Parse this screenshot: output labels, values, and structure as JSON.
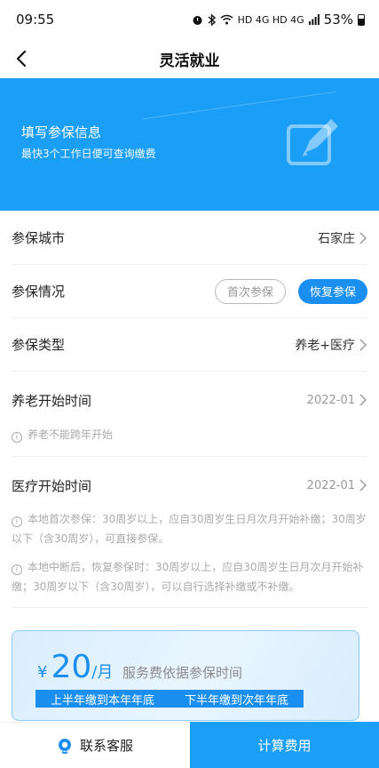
{
  "status_bar": {
    "time": "09:55",
    "network": "HD 4G HD 4G",
    "battery": "53%"
  },
  "nav": {
    "title": "灵活就业"
  },
  "banner": {
    "title": "填写参保信息",
    "subtitle": "最快3个工作日便可查询缴费"
  },
  "form": {
    "city": {
      "label": "参保城市",
      "value": "石家庄"
    },
    "status": {
      "label": "参保情况",
      "option_first": "首次参保",
      "option_resume": "恢复参保"
    },
    "type": {
      "label": "参保类型",
      "value": "养老+医疗"
    },
    "pension_start": {
      "label": "养老开始时间",
      "value": "2022-01",
      "note": "养老不能跨年开始"
    },
    "medical_start": {
      "label": "医疗开始时间",
      "value": "2022-01",
      "note1": "本地首次参保：30周岁以上，应自30周岁生日月次月开始补缴；30周岁以下（含30周岁），可直接参保。",
      "note2": "本地中断后，恢复参保时：30周岁以上，应自30周岁生日月次月开始补缴；30周岁以下（含30周岁），可以自行选择补缴或不补缴。"
    }
  },
  "fee": {
    "currency": "¥",
    "amount": "20",
    "unit": "/月",
    "desc": "服务费依据参保时间",
    "band_left": "上半年缴到本年年底",
    "band_right": "下半年缴到次年年底"
  },
  "bottom": {
    "service": "联系客服",
    "calculate": "计算费用"
  },
  "colors": {
    "primary": "#1b9ef5",
    "accent": "#1b8ff0"
  }
}
